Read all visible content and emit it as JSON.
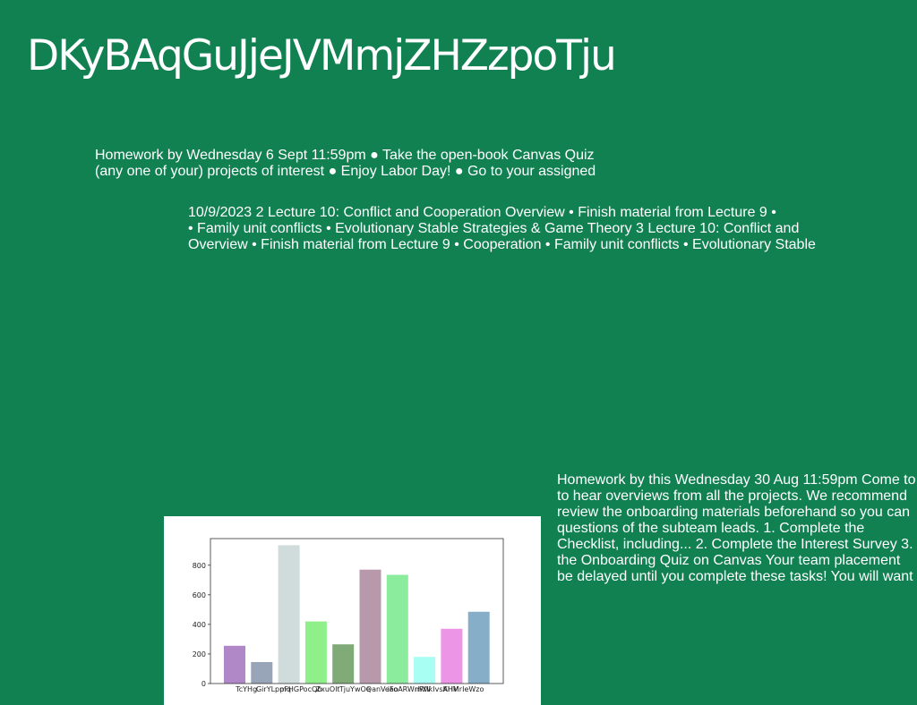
{
  "slide": {
    "title": "DKyBAqGuJjeJVMmjZHZzpoTju",
    "background_color": "#118152",
    "text_color": "#ffffff"
  },
  "textbox1": {
    "lines": [
      "Homework by Wednesday 6 Sept 11:59pm ● Take the open-book Canvas Quiz",
      "(any one of your) projects of interest ● Enjoy Labor Day! ● Go to your assigned"
    ]
  },
  "textbox2": {
    "lines": [
      "10/9/2023 2 Lecture 10: Conflict and Cooperation Overview • Finish material from Lecture 9 •",
      "• Family unit conflicts • Evolutionary Stable Strategies & Game Theory 3 Lecture 10: Conflict and",
      "Overview • Finish material from Lecture 9 • Cooperation • Family unit conflicts • Evolutionary Stable"
    ]
  },
  "textbox3": {
    "lines": [
      "Homework by this Wednesday 30 Aug 11:59pm Come to",
      "to hear overviews from all the projects. We recommend",
      "review the onboarding materials beforehand so you can",
      "questions of the subteam leads. 1. Complete the",
      "Checklist, including... 2. Complete the Interest Survey 3.",
      "the Onboarding Quiz on Canvas Your team placement",
      "be delayed until you complete these tasks! You will want"
    ]
  },
  "chart_data": {
    "type": "bar",
    "categories": [
      "TcYHg",
      "GirYLpmq",
      "pFHGPocQb",
      "ZxuOlt",
      "TjuYwOe",
      "QanVeao",
      "iFoARWnRW",
      "rhYIkIvsAHV",
      "KHMrIeWzo"
    ],
    "values": [
      255,
      145,
      935,
      420,
      265,
      770,
      735,
      180,
      370,
      485
    ],
    "bar_colors": [
      "#b088c8",
      "#98a4b8",
      "#cfdcdb",
      "#8ff08a",
      "#80aa78",
      "#b899ab",
      "#8aec9c",
      "#a8fef2",
      "#ec94e6",
      "#86aec8"
    ],
    "y_ticks": [
      0,
      200,
      400,
      600,
      800
    ],
    "ylim": [
      0,
      980
    ],
    "title": "",
    "xlabel": "",
    "ylabel": ""
  }
}
